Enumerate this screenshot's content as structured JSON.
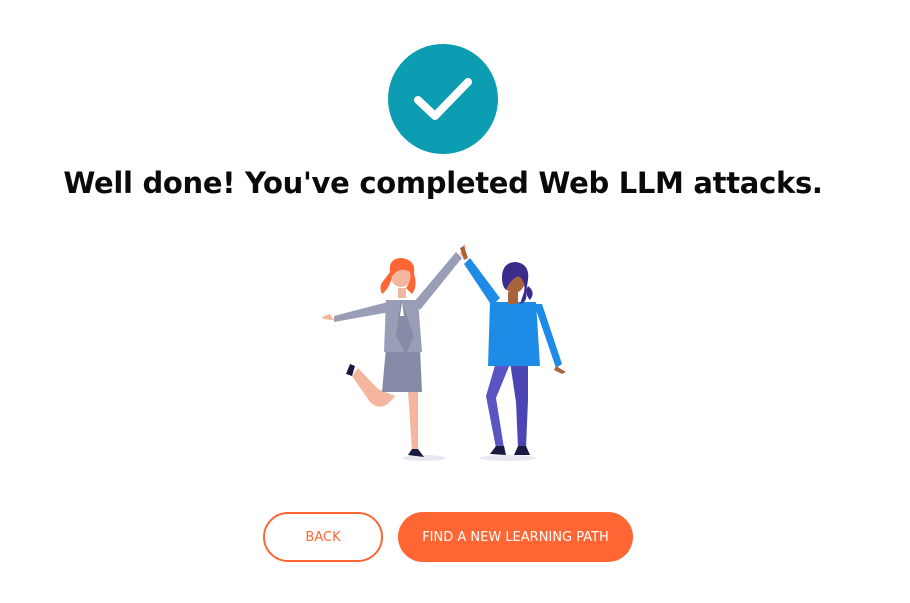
{
  "completion": {
    "headline": "Well done! You've completed Web LLM attacks."
  },
  "icons": {
    "badge": "checkmark-icon",
    "illustration": "high-five-illustration"
  },
  "buttons": {
    "back_label": "BACK",
    "primary_label": "FIND A NEW LEARNING PATH"
  },
  "colors": {
    "badge": "#0c9db2",
    "accent": "#ff6633",
    "headline": "#0a0a0a"
  }
}
